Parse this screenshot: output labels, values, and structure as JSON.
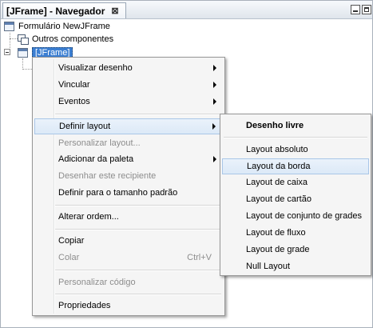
{
  "window": {
    "tab_title": "[JFrame] - Navegador",
    "close_glyph": "⊠"
  },
  "tree": {
    "form_root": "Formulário NewJFrame",
    "other_components": "Outros componentes",
    "jframe_node": "[JFrame]"
  },
  "context_menu": {
    "items": [
      {
        "label": "Visualizar desenho",
        "submenu": true
      },
      {
        "label": "Vincular",
        "submenu": true
      },
      {
        "label": "Eventos",
        "submenu": true
      },
      {
        "label": "Definir layout",
        "submenu": true
      },
      {
        "label": "Personalizar layout...",
        "disabled": true
      },
      {
        "label": "Adicionar da paleta",
        "submenu": true
      },
      {
        "label": "Desenhar este recipiente",
        "disabled": true
      },
      {
        "label": "Definir para o tamanho padrão"
      },
      {
        "label": "Alterar ordem..."
      },
      {
        "label": "Copiar"
      },
      {
        "label": "Colar",
        "shortcut": "Ctrl+V",
        "disabled": true
      },
      {
        "label": "Personalizar código",
        "disabled": true
      },
      {
        "label": "Propriedades"
      }
    ]
  },
  "layout_submenu": {
    "items": [
      {
        "label": "Desenho livre",
        "bold": true
      },
      {
        "label": "Layout absoluto"
      },
      {
        "label": "Layout da borda",
        "highlighted": true
      },
      {
        "label": "Layout de caixa"
      },
      {
        "label": "Layout de cartão"
      },
      {
        "label": "Layout de conjunto de grades"
      },
      {
        "label": "Layout de fluxo"
      },
      {
        "label": "Layout de grade"
      },
      {
        "label": "Null Layout"
      }
    ]
  }
}
